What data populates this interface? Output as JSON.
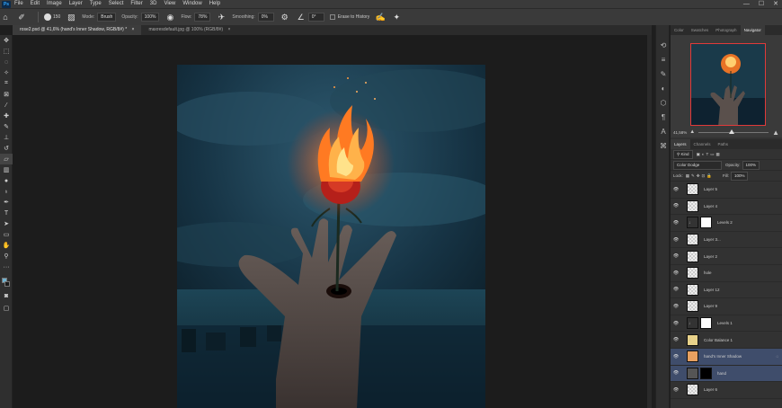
{
  "menubar": {
    "logo": "Ps",
    "items": [
      "File",
      "Edit",
      "Image",
      "Layer",
      "Type",
      "Select",
      "Filter",
      "3D",
      "View",
      "Window",
      "Help"
    ],
    "window_controls": [
      "—",
      "☐",
      "✕"
    ]
  },
  "options": {
    "brush_size": "150",
    "mode_label": "Mode:",
    "mode_value": "Brush",
    "opacity_label": "Opacity:",
    "opacity_value": "100%",
    "flow_label": "Flow:",
    "flow_value": "78%",
    "smoothing_label": "Smoothing:",
    "smoothing_value": "0%",
    "angle_value": "0°",
    "erase_history_label": "Erase to History"
  },
  "tabs": [
    {
      "label": "rose2.psd @ 41,6% (hand's Inner Shadow, RGB/8#) *",
      "active": true
    },
    {
      "label": "maxresdefault.jpg @ 100% (RGB/8#)",
      "active": false
    }
  ],
  "colors": {
    "foreground": "#6fb3d2",
    "background": "#1a1a1a",
    "accent": "#31a8ff",
    "nav_frame": "#e03a3a"
  },
  "navigator": {
    "tabs": [
      "Color",
      "Swatches",
      "Photograph",
      "Navigator"
    ],
    "active_tab": "Navigator",
    "zoom": "41,58%"
  },
  "layers_panel": {
    "tabs": [
      "Layers",
      "Channels",
      "Paths"
    ],
    "active_tab": "Layers",
    "filter_value": "Kind",
    "blend_mode": "Color Dodge",
    "opacity_label": "Opacity:",
    "opacity_value": "100%",
    "lock_label": "Lock:",
    "fill_label": "Fill:",
    "fill_value": "100%",
    "layers": [
      {
        "name": "Layer 5",
        "clipped": true,
        "mask": false,
        "selected": false
      },
      {
        "name": "Layer 4",
        "clipped": true,
        "mask": false,
        "selected": false
      },
      {
        "name": "Levels 2",
        "clipped": true,
        "mask": true,
        "selected": false
      },
      {
        "name": "Layer 3...",
        "clipped": false,
        "mask": false,
        "selected": false
      },
      {
        "name": "Layer 2",
        "clipped": true,
        "mask": false,
        "selected": false
      },
      {
        "name": "hole",
        "clipped": false,
        "mask": false,
        "selected": false
      },
      {
        "name": "Layer 12",
        "clipped": true,
        "mask": false,
        "selected": false
      },
      {
        "name": "Layer 9",
        "clipped": true,
        "mask": false,
        "selected": false
      },
      {
        "name": "Levels 1",
        "clipped": true,
        "mask": true,
        "selected": false
      },
      {
        "name": "Color Balance 1",
        "clipped": true,
        "mask": false,
        "selected": false
      },
      {
        "name": "hand's Inner Shadow",
        "clipped": false,
        "mask": false,
        "selected": true
      },
      {
        "name": "hand",
        "clipped": false,
        "mask": true,
        "selected": true
      },
      {
        "name": "Layer 6",
        "clipped": false,
        "mask": false,
        "selected": false
      }
    ]
  },
  "tools": [
    "move-icon",
    "marquee-icon",
    "lasso-icon",
    "magic-wand-icon",
    "crop-icon",
    "frame-icon",
    "eyedropper-icon",
    "healing-icon",
    "brush-icon",
    "stamp-icon",
    "history-brush-icon",
    "eraser-icon",
    "gradient-icon",
    "blur-icon",
    "dodge-icon",
    "pen-icon",
    "type-icon",
    "path-select-icon",
    "shape-icon",
    "hand-icon",
    "zoom-icon",
    "more-icon"
  ]
}
